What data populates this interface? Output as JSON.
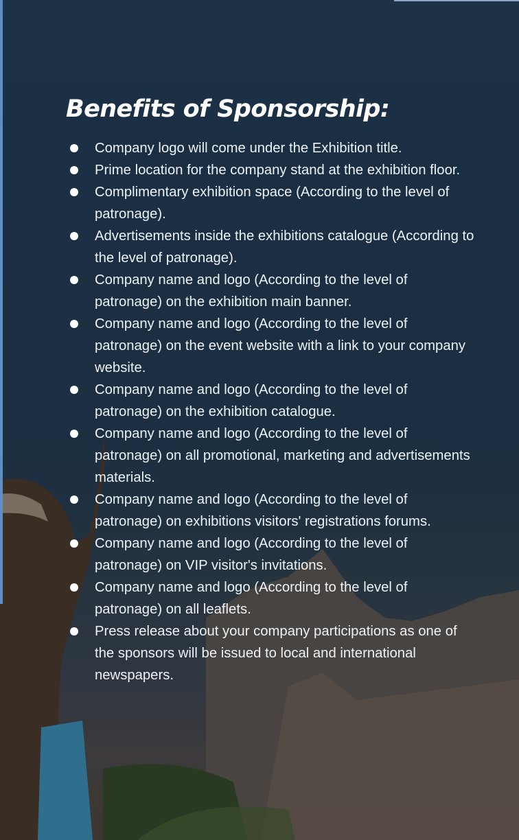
{
  "page": {
    "title": "Benefits of Sponsorship:",
    "benefits": [
      {
        "text": "Company logo will come under the Exhibition title."
      },
      {
        "text": "Prime location for the company stand at the exhibition floor."
      },
      {
        "text": "Complimentary exhibition space (According to the level of patronage)."
      },
      {
        "text": "Advertisements inside the exhibitions catalogue (According to the level of patronage)."
      },
      {
        "text": "Company name and logo (According to the level of patronage) on the exhibition main banner."
      },
      {
        "text": "Company name and logo (According to the level of patronage) on the event website with a link to your company website."
      },
      {
        "text": "Company name and logo (According to the level of patronage) on the exhibition catalogue."
      },
      {
        "text": "Company name and logo (According to the level of patronage) on all promotional, marketing and advertisements materials."
      },
      {
        "text": "Company name and logo (According to the level of patronage) on exhibitions visitors' registrations forums."
      },
      {
        "text": "Company name and logo (According to the level of patronage) on VIP visitor's invitations."
      },
      {
        "text": "Company name and logo (According to the level of patronage) on all leaflets."
      },
      {
        "text": "Press release about your company participations as one of the sponsors will be issued to local and international newspapers."
      }
    ]
  },
  "colors": {
    "background": "#1b2e42",
    "text": "#eef2f6",
    "title": "#ffffff",
    "bullet": "#ffffff"
  }
}
